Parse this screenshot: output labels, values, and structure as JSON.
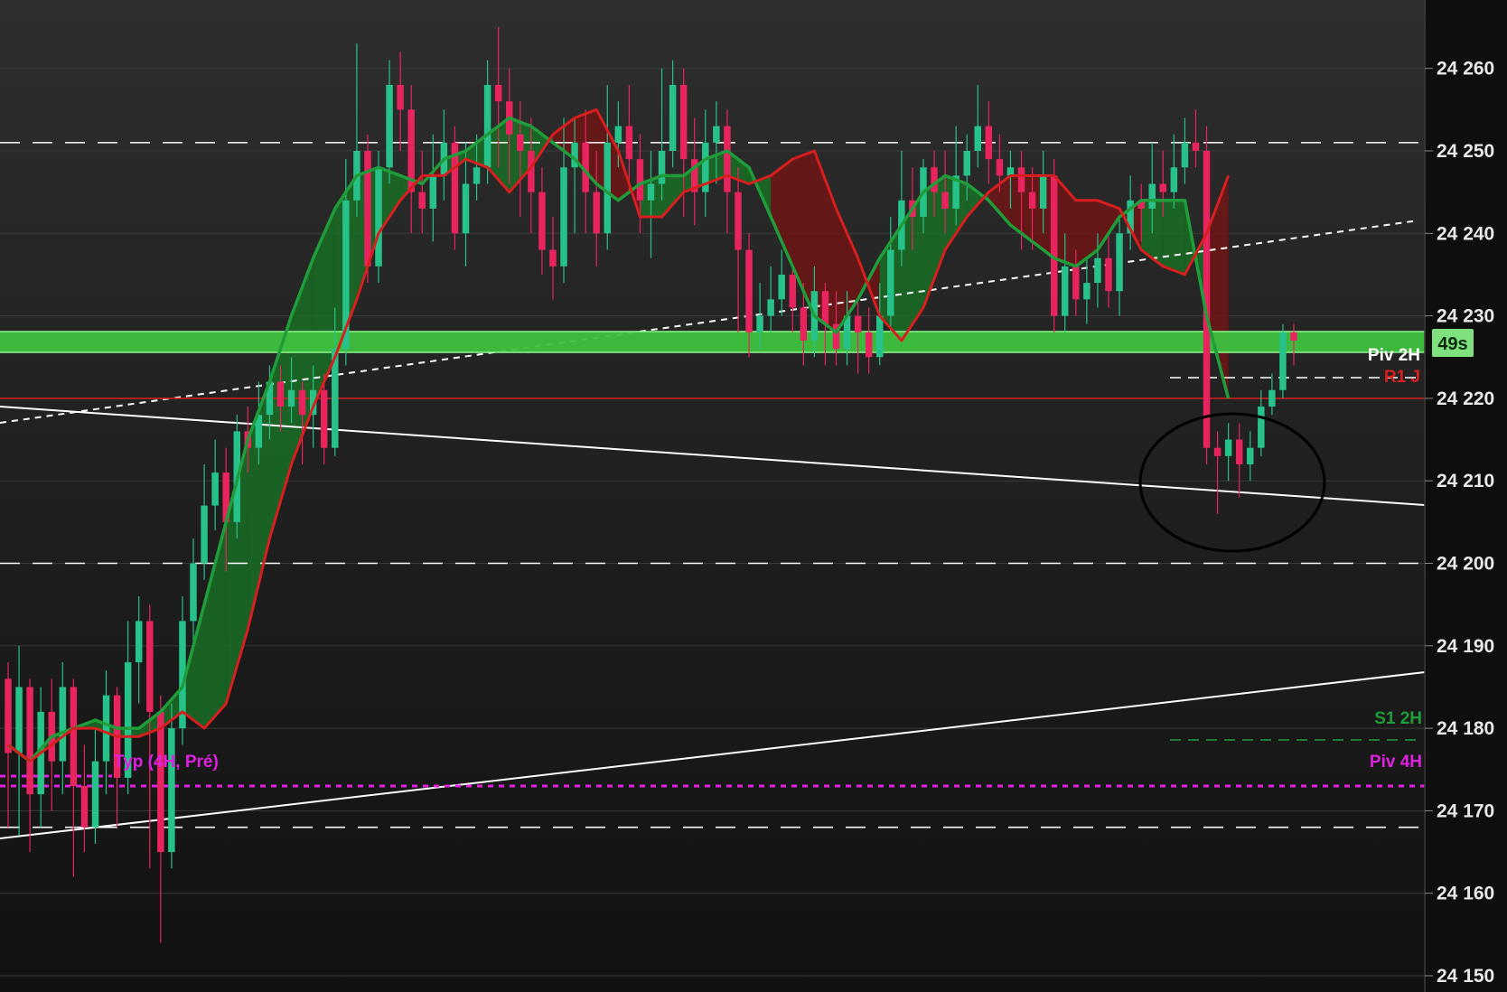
{
  "chart_data": {
    "type": "candlestick",
    "ylim": [
      24149,
      24264
    ],
    "y_ticks": [
      {
        "value": 24260,
        "label": "24 260"
      },
      {
        "value": 24250,
        "label": "24 250"
      },
      {
        "value": 24240,
        "label": "24 240"
      },
      {
        "value": 24230,
        "label": "24 230"
      },
      {
        "value": 24220,
        "label": "24 220"
      },
      {
        "value": 24210,
        "label": "24 210"
      },
      {
        "value": 24200,
        "label": "24 200"
      },
      {
        "value": 24190,
        "label": "24 190"
      },
      {
        "value": 24180,
        "label": "24 180"
      },
      {
        "value": 24170,
        "label": "24 170"
      },
      {
        "value": 24160,
        "label": "24 160"
      },
      {
        "value": 24150,
        "label": "24 150"
      }
    ],
    "grid": true,
    "candles": [
      [
        24186,
        24177,
        24188,
        24168
      ],
      [
        24177,
        24185,
        24190,
        24167
      ],
      [
        24185,
        24172,
        24186,
        24165
      ],
      [
        24172,
        24182,
        24185,
        24168
      ],
      [
        24182,
        24176,
        24186,
        24170
      ],
      [
        24176,
        24185,
        24188,
        24172
      ],
      [
        24185,
        24173,
        24186,
        24162
      ],
      [
        24173,
        24168,
        24178,
        24165
      ],
      [
        24168,
        24176,
        24180,
        24166
      ],
      [
        24176,
        24184,
        24187,
        24172
      ],
      [
        24184,
        24174,
        24185,
        24168
      ],
      [
        24174,
        24188,
        24193,
        24172
      ],
      [
        24188,
        24193,
        24196,
        24183
      ],
      [
        24193,
        24182,
        24195,
        24163
      ],
      [
        24182,
        24165,
        24184,
        24154
      ],
      [
        24165,
        24180,
        24183,
        24163
      ],
      [
        24180,
        24193,
        24196,
        24178
      ],
      [
        24193,
        24200,
        24203,
        24190
      ],
      [
        24200,
        24207,
        24212,
        24198
      ],
      [
        24207,
        24211,
        24215,
        24204
      ],
      [
        24211,
        24205,
        24214,
        24199
      ],
      [
        24205,
        24216,
        24218,
        24203
      ],
      [
        24216,
        24214,
        24219,
        24211
      ],
      [
        24214,
        24218,
        24222,
        24212
      ],
      [
        24218,
        24222,
        24224,
        24215
      ],
      [
        24222,
        24219,
        24224,
        24216
      ],
      [
        24219,
        24221,
        24225,
        24217
      ],
      [
        24221,
        24218,
        24222,
        24212
      ],
      [
        24218,
        24221,
        24224,
        24214
      ],
      [
        24221,
        24214,
        24223,
        24212
      ],
      [
        24214,
        24226,
        24231,
        24213
      ],
      [
        24226,
        24244,
        24249,
        24224
      ],
      [
        24244,
        24250,
        24263,
        24242
      ],
      [
        24250,
        24236,
        24252,
        24234
      ],
      [
        24236,
        24248,
        24250,
        24234
      ],
      [
        24248,
        24258,
        24261,
        24246
      ],
      [
        24258,
        24255,
        24262,
        24250
      ],
      [
        24255,
        24245,
        24258,
        24240
      ],
      [
        24245,
        24243,
        24250,
        24240
      ],
      [
        24243,
        24247,
        24252,
        24239
      ],
      [
        24247,
        24251,
        24255,
        24244
      ],
      [
        24251,
        24240,
        24253,
        24238
      ],
      [
        24240,
        24246,
        24251,
        24236
      ],
      [
        24246,
        24248,
        24252,
        24244
      ],
      [
        24248,
        24258,
        24261,
        24246
      ],
      [
        24258,
        24256,
        24265,
        24248
      ],
      [
        24256,
        24252,
        24260,
        24246
      ],
      [
        24252,
        24250,
        24256,
        24242
      ],
      [
        24250,
        24245,
        24254,
        24240
      ],
      [
        24245,
        24238,
        24248,
        24235
      ],
      [
        24238,
        24236,
        24242,
        24232
      ],
      [
        24236,
        24248,
        24254,
        24234
      ],
      [
        24248,
        24251,
        24254,
        24240
      ],
      [
        24251,
        24245,
        24255,
        24240
      ],
      [
        24245,
        24240,
        24250,
        24236
      ],
      [
        24240,
        24251,
        24258,
        24238
      ],
      [
        24251,
        24253,
        24256,
        24248
      ],
      [
        24253,
        24249,
        24258,
        24245
      ],
      [
        24249,
        24244,
        24252,
        24240
      ],
      [
        24244,
        24246,
        24250,
        24237
      ],
      [
        24246,
        24250,
        24260,
        24244
      ],
      [
        24250,
        24258,
        24261,
        24248
      ],
      [
        24258,
        24249,
        24260,
        24242
      ],
      [
        24249,
        24245,
        24254,
        24241
      ],
      [
        24245,
        24251,
        24255,
        24242
      ],
      [
        24251,
        24253,
        24256,
        24246
      ],
      [
        24253,
        24245,
        24255,
        24240
      ],
      [
        24245,
        24238,
        24248,
        24228
      ],
      [
        24238,
        24228,
        24240,
        24225
      ],
      [
        24228,
        24230,
        24234,
        24226
      ],
      [
        24230,
        24232,
        24236,
        24228
      ],
      [
        24232,
        24235,
        24238,
        24230
      ],
      [
        24235,
        24231,
        24236,
        24228
      ],
      [
        24231,
        24227,
        24234,
        24224
      ],
      [
        24227,
        24233,
        24236,
        24225
      ],
      [
        24233,
        24229,
        24234,
        24224
      ],
      [
        24229,
        24226,
        24233,
        24224
      ],
      [
        24226,
        24230,
        24233,
        24224
      ],
      [
        24230,
        24228,
        24232,
        24223
      ],
      [
        24228,
        24225,
        24231,
        24223
      ],
      [
        24225,
        24230,
        24234,
        24224
      ],
      [
        24230,
        24238,
        24242,
        24228
      ],
      [
        24238,
        24244,
        24250,
        24236
      ],
      [
        24244,
        24242,
        24248,
        24238
      ],
      [
        24242,
        24248,
        24249,
        24240
      ],
      [
        24248,
        24245,
        24250,
        24242
      ],
      [
        24245,
        24243,
        24250,
        24240
      ],
      [
        24243,
        24247,
        24253,
        24241
      ],
      [
        24247,
        24250,
        24252,
        24244
      ],
      [
        24250,
        24253,
        24258,
        24248
      ],
      [
        24253,
        24249,
        24256,
        24246
      ],
      [
        24249,
        24247,
        24252,
        24245
      ],
      [
        24247,
        24248,
        24250,
        24243
      ],
      [
        24248,
        24245,
        24250,
        24238
      ],
      [
        24245,
        24243,
        24248,
        24238
      ],
      [
        24243,
        24247,
        24250,
        24240
      ],
      [
        24247,
        24230,
        24249,
        24228
      ],
      [
        24230,
        24236,
        24240,
        24228
      ],
      [
        24236,
        24232,
        24238,
        24230
      ],
      [
        24232,
        24234,
        24237,
        24229
      ],
      [
        24234,
        24237,
        24240,
        24231
      ],
      [
        24237,
        24233,
        24240,
        24231
      ],
      [
        24233,
        24240,
        24242,
        24230
      ],
      [
        24240,
        24244,
        24247,
        24238
      ],
      [
        24244,
        24243,
        24246,
        24239
      ],
      [
        24243,
        24246,
        24251,
        24240
      ],
      [
        24246,
        24245,
        24250,
        24242
      ],
      [
        24245,
        24248,
        24252,
        24243
      ],
      [
        24248,
        24251,
        24254,
        24246
      ],
      [
        24251,
        24250,
        24255,
        24248
      ],
      [
        24250,
        24214,
        24253,
        24212
      ],
      [
        24214,
        24213,
        24216,
        24206
      ],
      [
        24213,
        24215,
        24217,
        24210
      ],
      [
        24215,
        24212,
        24217,
        24208
      ],
      [
        24212,
        24214,
        24216,
        24210
      ],
      [
        24214,
        24219,
        24221,
        24213
      ],
      [
        24219,
        24221,
        24223,
        24218
      ],
      [
        24221,
        24228,
        24229,
        24220
      ],
      [
        24228,
        24227,
        24229,
        24224
      ]
    ],
    "moving_averages": {
      "fast": [
        24178,
        24176,
        24178,
        24180,
        24180,
        24179,
        24179,
        24180,
        24182,
        24180,
        24183,
        24192,
        24203,
        24212,
        24219,
        24225,
        24232,
        24240,
        24244,
        24247,
        24247,
        24249,
        24248,
        24245,
        24248,
        24252,
        24254,
        24255,
        24250,
        24242,
        24242,
        24245,
        24246,
        24247,
        24246,
        24247,
        24249,
        24250,
        24243,
        24237,
        24230,
        24227,
        24231,
        24238,
        24242,
        24245,
        24247,
        24247,
        24247,
        24244,
        24244,
        24243,
        24238,
        24236,
        24235,
        24240,
        24247
      ],
      "slow": [
        24178,
        24176,
        24179,
        24180,
        24181,
        24180,
        24180,
        24182,
        24185,
        24195,
        24205,
        24215,
        24222,
        24230,
        24237,
        24243,
        24247,
        24248,
        24247,
        24246,
        24249,
        24250,
        24252,
        24254,
        24253,
        24251,
        24249,
        24246,
        24244,
        24246,
        24247,
        24247,
        24249,
        24250,
        24248,
        24242,
        24236,
        24230,
        24228,
        24232,
        24237,
        24241,
        24245,
        24247,
        24246,
        24244,
        24241,
        24239,
        24237,
        24236,
        24238,
        24242,
        24244,
        24244,
        24244,
        24230,
        24220
      ]
    },
    "horizontal_levels": [
      {
        "value": 24251,
        "style": "dashed",
        "color": "#ffffff"
      },
      {
        "value": 24200,
        "style": "dashed",
        "color": "#ffffff"
      },
      {
        "value": 24168,
        "style": "dashed",
        "color": "#ffffff"
      },
      {
        "value": 24220,
        "style": "solid",
        "color": "#cc1f1f"
      },
      {
        "value": 24173,
        "style": "dotted",
        "color": "#e020e0"
      }
    ],
    "zone": {
      "from": 24226,
      "to": 24228,
      "color": "#3ec13e"
    },
    "annotations": {
      "piv_2h": "Piv 2H",
      "r1_j": "R1 J",
      "s1_2h": "S1 2H",
      "piv_4h": "Piv 4H",
      "typ_4h": "Typ (4H, Pré)",
      "timer": "49s"
    },
    "colors": {
      "bull": "#26c28a",
      "bear": "#e8245e",
      "fast_ma": "#d81e1e",
      "slow_ma": "#1f9d3a",
      "cloud_bull": "#1a6f24",
      "cloud_bear": "#6e1515"
    }
  }
}
